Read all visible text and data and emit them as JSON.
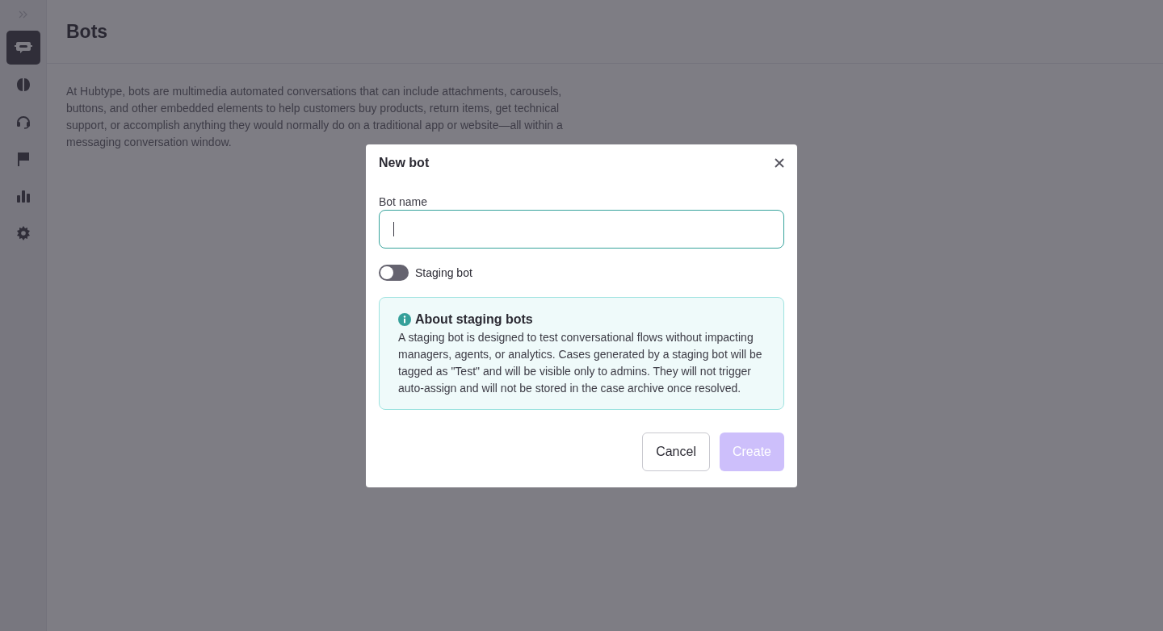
{
  "sidebar": {
    "items": [
      {
        "kind": "bot",
        "selected": true
      },
      {
        "kind": "brain",
        "selected": false
      },
      {
        "kind": "headset",
        "selected": false
      },
      {
        "kind": "flag",
        "selected": false
      },
      {
        "kind": "chart",
        "selected": false
      },
      {
        "kind": "gear",
        "selected": false
      }
    ]
  },
  "page": {
    "title": "Bots",
    "description": "At Hubtype, bots are multimedia automated conversations that can include attachments, carousels, buttons, and other embedded elements to help customers buy products, return items, get technical support, or accomplish anything they would normally do on a traditional app or website—all within a messaging conversation window."
  },
  "dialog": {
    "title": "New bot",
    "field": {
      "label": "Bot name",
      "focused": true
    },
    "toggle": {
      "label": "Staging bot",
      "on": false
    },
    "info": {
      "title": "About staging bots",
      "text": "A staging bot is designed to test conversational flows without impacting managers, agents, or analytics. Cases generated by a staging bot will be tagged as \"Test\" and will be visible only to admins. They will not trigger auto-assign and will not be stored in the case archive once resolved."
    },
    "buttons": [
      {
        "label": "Cancel",
        "kind": "secondary",
        "disabled": false
      },
      {
        "label": "Create",
        "kind": "primary",
        "disabled": true
      }
    ]
  }
}
